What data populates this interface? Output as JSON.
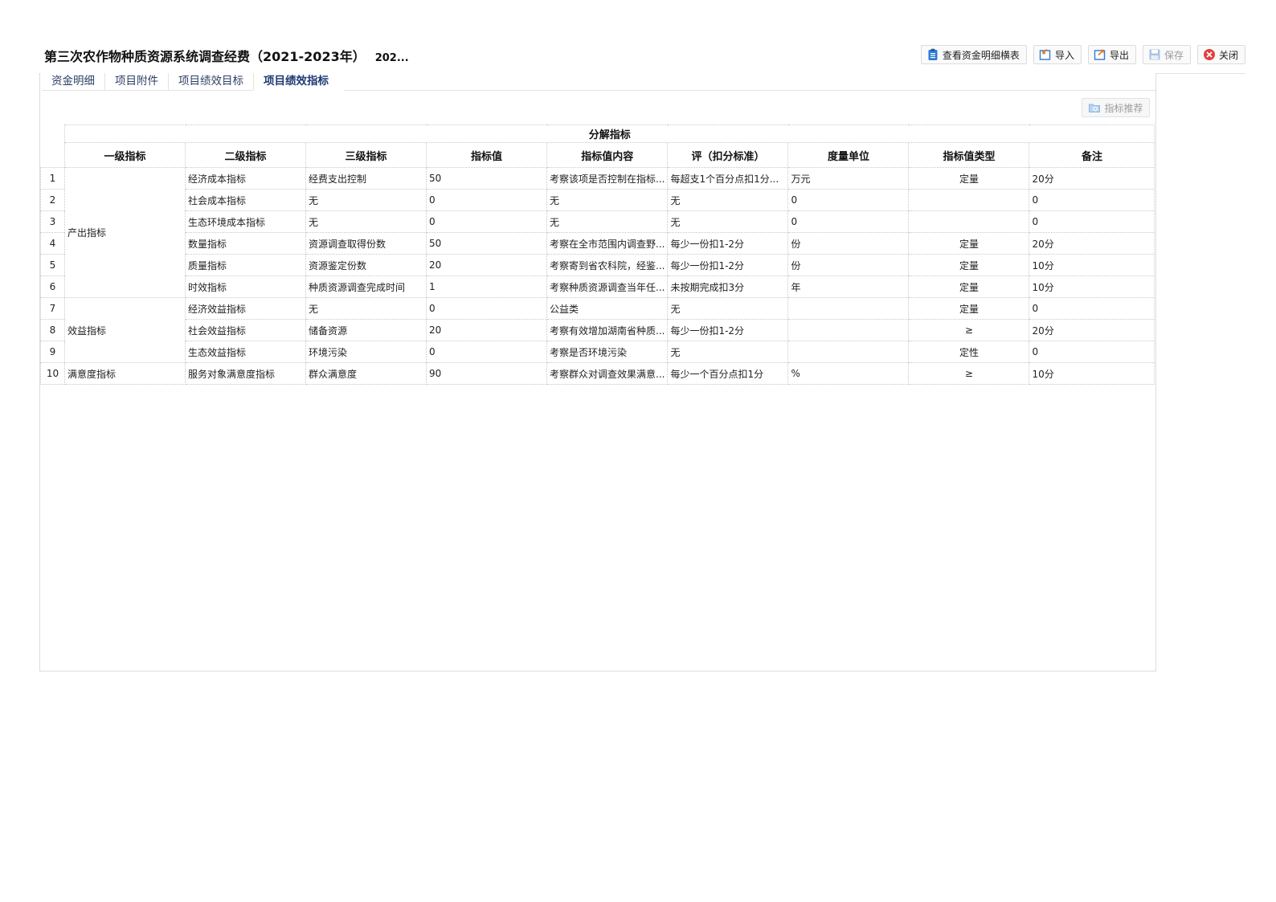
{
  "header": {
    "title": "第三次农作物种质资源系统调查经费（2021-2023年）",
    "subtitle": "202..."
  },
  "toolbar": {
    "view_detail": "查看资金明细横表",
    "import": "导入",
    "export": "导出",
    "save": "保存",
    "close": "关闭"
  },
  "tabs": [
    "资金明细",
    "项目附件",
    "项目绩效目标",
    "项目绩效指标"
  ],
  "recommend_button": "指标推荐",
  "table": {
    "group_header": "分解指标",
    "columns": [
      "一级指标",
      "二级指标",
      "三级指标",
      "指标值",
      "指标值内容",
      "评（扣分标准）",
      "度量单位",
      "指标值类型",
      "备注"
    ],
    "level1": [
      "产出指标",
      "效益指标",
      "满意度指标"
    ],
    "rows": [
      {
        "n": "1",
        "l2": "经济成本指标",
        "l3": "经费支出控制",
        "val": "50",
        "content": "考察该项是否控制在指标...",
        "std": "每超支1个百分点扣1分...",
        "unit": "万元",
        "type": "定量",
        "note": "20分"
      },
      {
        "n": "2",
        "l2": "社会成本指标",
        "l3": "无",
        "val": "0",
        "content": "无",
        "std": "无",
        "unit": "0",
        "type": "",
        "note": "0"
      },
      {
        "n": "3",
        "l2": "生态环境成本指标",
        "l3": "无",
        "val": "0",
        "content": "无",
        "std": "无",
        "unit": "0",
        "type": "",
        "note": "0"
      },
      {
        "n": "4",
        "l2": "数量指标",
        "l3": "资源调查取得份数",
        "val": "50",
        "content": "考察在全市范围内调查野...",
        "std": "每少一份扣1-2分",
        "unit": "份",
        "type": "定量",
        "note": "20分"
      },
      {
        "n": "5",
        "l2": "质量指标",
        "l3": "资源鉴定份数",
        "val": "20",
        "content": "考察寄到省农科院，经鉴...",
        "std": "每少一份扣1-2分",
        "unit": "份",
        "type": "定量",
        "note": "10分"
      },
      {
        "n": "6",
        "l2": "时效指标",
        "l3": "种质资源调查完成时间",
        "val": "1",
        "content": "考察种质资源调查当年任...",
        "std": "未按期完成扣3分",
        "unit": "年",
        "type": "定量",
        "note": "10分"
      },
      {
        "n": "7",
        "l2": "经济效益指标",
        "l3": "无",
        "val": "0",
        "content": "公益类",
        "std": "无",
        "unit": "",
        "type": "定量",
        "note": "0"
      },
      {
        "n": "8",
        "l2": "社会效益指标",
        "l3": "储备资源",
        "val": "20",
        "content": "考察有效增加湖南省种质...",
        "std": "每少一份扣1-2分",
        "unit": "",
        "type": "≥",
        "note": "20分"
      },
      {
        "n": "9",
        "l2": "生态效益指标",
        "l3": "环境污染",
        "val": "0",
        "content": "考察是否环境污染",
        "std": "无",
        "unit": "",
        "type": "定性",
        "note": "0"
      },
      {
        "n": "10",
        "l2": "服务对象满意度指标",
        "l3": "群众满意度",
        "val": "90",
        "content": "考察群众对调查效果满意...",
        "std": "每少一个百分点扣1分",
        "unit": "%",
        "type": "≥",
        "note": "10分"
      }
    ]
  },
  "icons": {
    "view_detail": "clipboard-icon",
    "import": "import-icon",
    "export": "export-icon",
    "save": "floppy-icon",
    "close": "close-circle-icon",
    "recommend": "folder-icon"
  },
  "colors": {
    "accent": "#2f7bd3",
    "close": "#e0413f",
    "tab_active": "#203a72"
  }
}
